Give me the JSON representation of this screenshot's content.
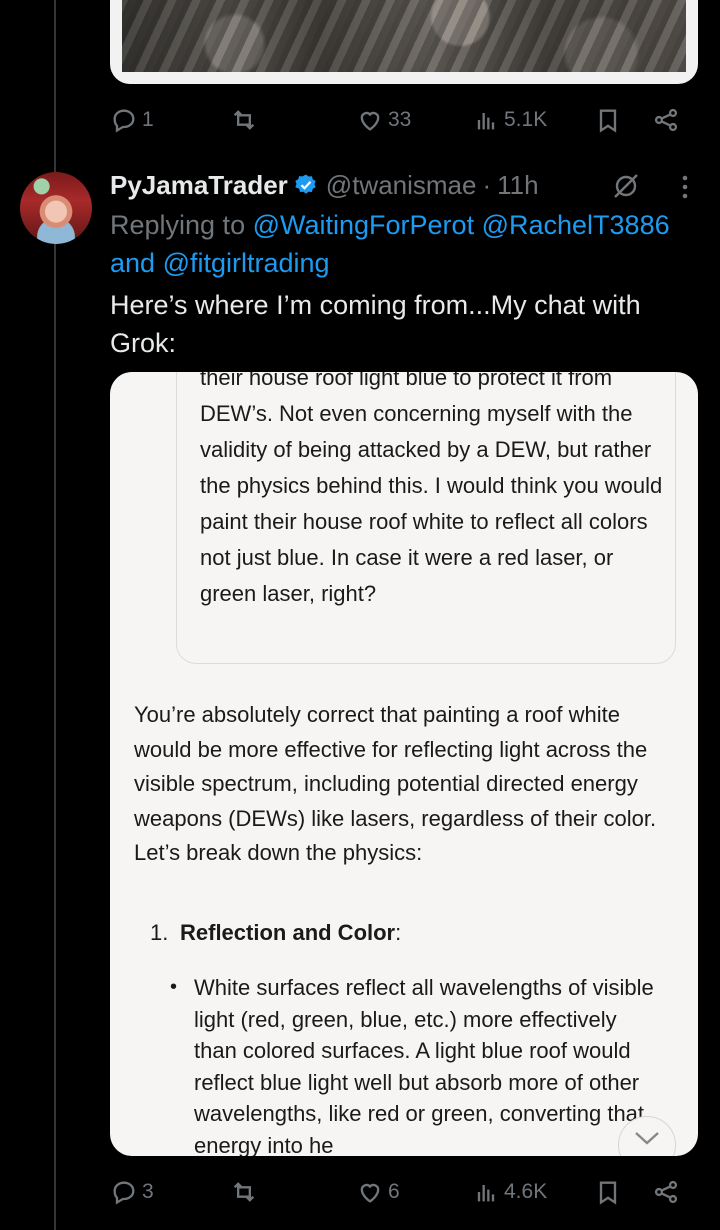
{
  "prev_tweet": {
    "actions": {
      "replies": "1",
      "likes": "33",
      "views": "5.1K"
    }
  },
  "tweet": {
    "display_name": "PyJamaTrader",
    "handle": "@twanismae",
    "separator": "·",
    "time": "11h",
    "replying_prefix": "Replying to ",
    "mentions": [
      "@WaitingForPerot",
      "@RachelT3886"
    ],
    "mentions_joiner": "and",
    "last_mention": "@fitgirltrading",
    "text": "Here’s where I’m coming from...My chat with Grok:",
    "actions": {
      "replies": "3",
      "likes": "6",
      "views": "4.6K"
    }
  },
  "screenshot": {
    "user_message": "their house roof light blue to protect it from DEW’s. Not even concerning myself with the validity of being attacked by a DEW, but rather the physics behind this. I would think you would paint their house roof white to reflect all colors not just blue. In case it were a red laser, or green laser, right?",
    "answer_intro": "You’re absolutely correct that painting a roof white would be more effective for reflecting light across the visible spectrum, including potential directed energy weapons (DEWs) like lasers, regardless of their color. Let’s break down the physics:",
    "list_number": "1.",
    "list_title": "Reflection and Color",
    "list_title_suffix": ":",
    "bullet_text": "White surfaces reflect all wavelengths of visible light (red, green, blue, etc.) more effectively than colored surfaces. A light blue roof would reflect blue light well but absorb more of other wavelengths, like red or green, converting that energy into he"
  },
  "colors": {
    "background": "#000000",
    "text_primary": "#e7e9ea",
    "text_secondary": "#71767b",
    "accent": "#1d9bf0"
  },
  "icons": [
    "reply-icon",
    "retweet-icon",
    "like-icon",
    "views-icon",
    "bookmark-icon",
    "share-icon",
    "verified-icon",
    "grok-icon",
    "more-icon",
    "chevron-down-icon"
  ]
}
